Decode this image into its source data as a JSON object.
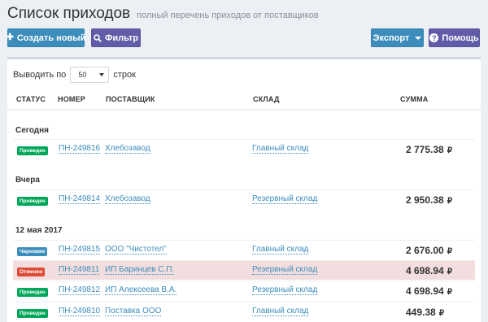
{
  "header": {
    "title": "Список приходов",
    "subtitle": "полный перечень приходов от поставщиков"
  },
  "toolbar": {
    "create_label": "Создать новый",
    "filter_label": "Фильтр",
    "export_label": "Экспорт",
    "help_label": "Помощь"
  },
  "table_controls": {
    "show_prefix": "Выводить по",
    "page_size": "50",
    "show_suffix": "строк"
  },
  "columns": {
    "status": "СТАТУС",
    "number": "НОМЕР",
    "supplier": "ПОСТАВЩИК",
    "warehouse": "СКЛАД",
    "amount": "СУММА"
  },
  "currency": "₽",
  "groups": [
    {
      "label": "Сегодня",
      "rows": [
        {
          "status": "Проведен",
          "number": "ПН-249816",
          "supplier": "Хлебозавод",
          "warehouse": "Главный склад",
          "amount": "2 775.38"
        }
      ]
    },
    {
      "label": "Вчера",
      "rows": [
        {
          "status": "Проведен",
          "number": "ПН-249814",
          "supplier": "Хлебозавод",
          "warehouse": "Резервный склад",
          "amount": "2 950.38"
        }
      ]
    },
    {
      "label": "12 мая 2017",
      "rows": [
        {
          "status": "Черновик",
          "number": "ПН-249815",
          "supplier": "ООО \"Чистотел\"",
          "warehouse": "Главный склад",
          "amount": "2 676.00"
        },
        {
          "status": "Отменен",
          "number": "ПН-249811",
          "supplier": "ИП Баринцев С.П.",
          "warehouse": "Резервный склад",
          "amount": "4 698.94"
        },
        {
          "status": "Проведен",
          "number": "ПН-249812",
          "supplier": "ИП Алексеева В.А.",
          "warehouse": "Резервный склад",
          "amount": "4 698.94"
        },
        {
          "status": "Проведен",
          "number": "ПН-249810",
          "supplier": "Поставка ООО",
          "warehouse": "Главный склад",
          "amount": "449.38"
        }
      ]
    }
  ],
  "colors": {
    "primary": "#3c8dbc",
    "purple": "#605ca8",
    "posted": "#00a65a",
    "draft": "#3c8dbc",
    "cancelled": "#dd4b39",
    "cancelled_row": "#f2dede"
  },
  "icons": {
    "create": "plus-icon",
    "filter": "search-icon",
    "export": "caret-down-icon",
    "help": "question-circle-icon",
    "select": "caret-down-icon"
  }
}
